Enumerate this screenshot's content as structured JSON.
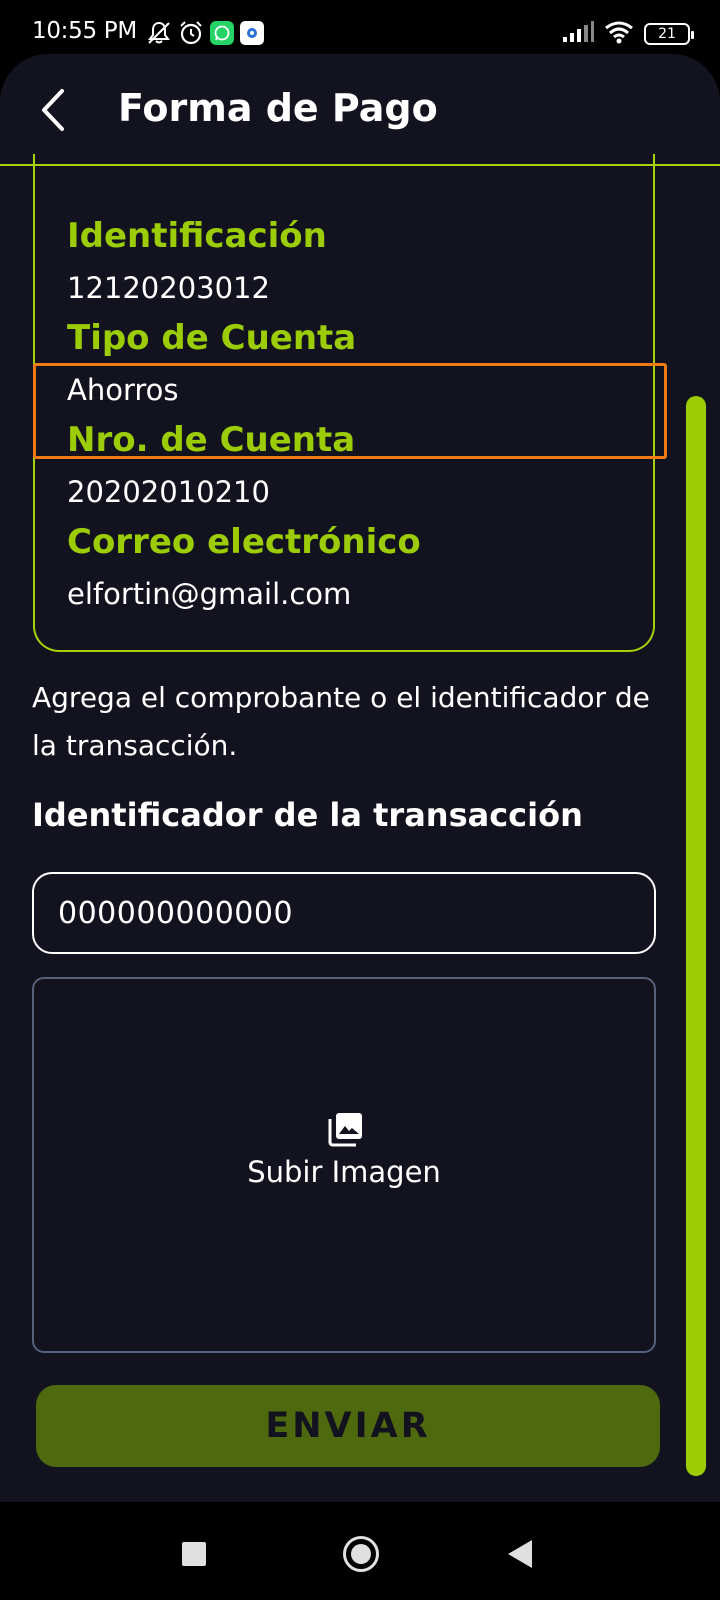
{
  "status_bar": {
    "time": "10:55 PM",
    "battery": "21",
    "icons_left": [
      "muted-icon",
      "alarm-icon",
      "whatsapp-icon",
      "app-notification-icon"
    ],
    "icons_right": [
      "signal-icon",
      "wifi-icon",
      "battery-icon"
    ]
  },
  "header": {
    "title": "Forma de Pago"
  },
  "account_info": {
    "identification_label": "Identificación",
    "identification_value": "12120203012",
    "account_type_label": "Tipo de Cuenta",
    "account_type_value": "Ahorros",
    "account_number_label": "Nro. de Cuenta",
    "account_number_value": "20202010210",
    "email_label": "Correo electrónico",
    "email_value": "elfortin@gmail.com"
  },
  "instructions": "Agrega el comprobante o el identificador de la transacción.",
  "transaction": {
    "section_title": "Identificador de la transacción",
    "input_value": "000000000000"
  },
  "upload": {
    "label": "Subir Imagen"
  },
  "submit": {
    "label": "ENVIAR"
  },
  "colors": {
    "accent": "#9ccc05",
    "background": "#12131f",
    "highlight": "#f07a14",
    "button": "#4f6a0e"
  }
}
